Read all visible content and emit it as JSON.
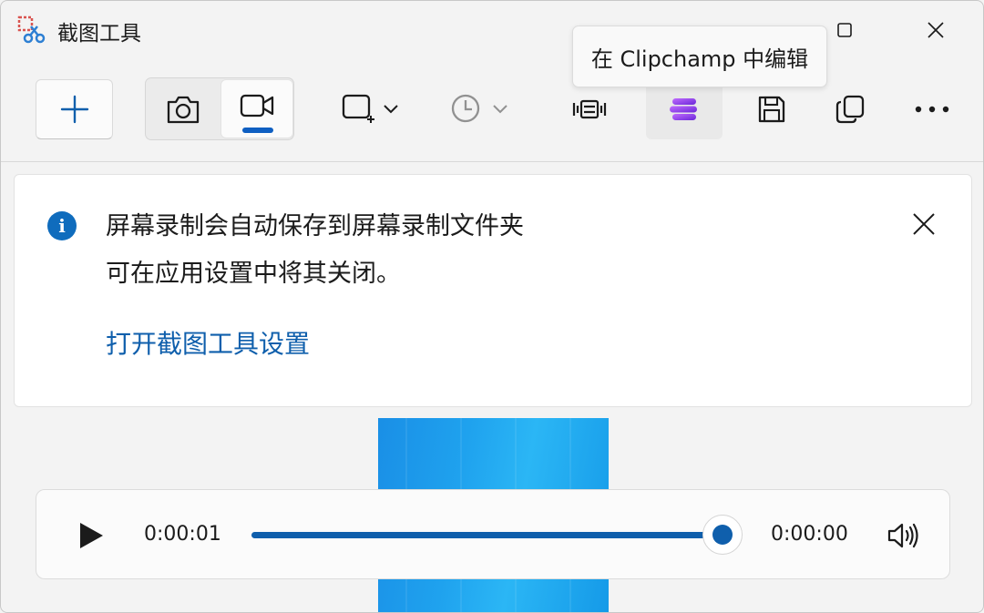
{
  "window": {
    "title": "截图工具",
    "accent": "#0f5fac"
  },
  "tooltip": {
    "text": "在 Clipchamp 中编辑"
  },
  "toolbar": {
    "new_icon": "plus-icon",
    "modes": [
      {
        "name": "snip",
        "icon": "camera-icon",
        "selected": false
      },
      {
        "name": "record",
        "icon": "video-camera-icon",
        "selected": true
      }
    ],
    "shape_icon": "rectangle-snip-icon",
    "timer_icon": "clock-icon",
    "actions": [
      "text-actions-icon",
      "clipchamp-icon",
      "save-icon",
      "copy-icon",
      "more-icon"
    ]
  },
  "infobar": {
    "title": "屏幕录制会自动保存到屏幕录制文件夹",
    "body": "可在应用设置中将其关闭。",
    "link": "打开截图工具设置"
  },
  "player": {
    "current_time": "0:00:01",
    "total_time": "0:00:00",
    "progress": 1.0
  }
}
